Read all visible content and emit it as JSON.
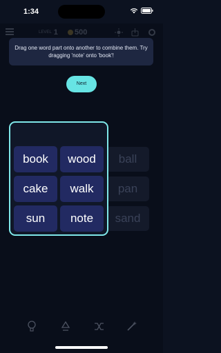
{
  "status": {
    "time": "1:34"
  },
  "header": {
    "level_label": "LEVEL",
    "level_value": "1",
    "coins": "500"
  },
  "tutorial": {
    "message": "Drag one word part onto another to combine them. Try dragging 'note' onto 'book'!",
    "next_label": "Next"
  },
  "tiles": {
    "highlighted": [
      "book",
      "wood",
      "cake",
      "walk",
      "sun",
      "note"
    ],
    "faded": [
      "ball",
      "pan",
      "sand"
    ]
  },
  "toolbar": {
    "items": [
      "lightbulb-icon",
      "recycle-icon",
      "shuffle-icon",
      "magic-wand-icon"
    ]
  },
  "colors": {
    "background": "#0c1220",
    "tile": "#222a62",
    "accent": "#67e4e4",
    "frame": "#7fe8ea"
  }
}
